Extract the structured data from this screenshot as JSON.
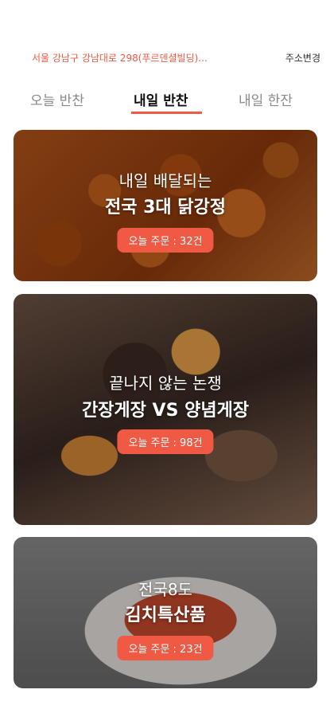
{
  "header": {
    "address": "서울 강남구 강남대로 298(푸르덴셜빌딩)...",
    "change_address": "주소변경"
  },
  "tabs": [
    {
      "label": "오늘 반찬",
      "active": false
    },
    {
      "label": "내일 반찬",
      "active": true
    },
    {
      "label": "내일 한잔",
      "active": false
    }
  ],
  "cards": [
    {
      "subtitle": "내일 배달되는",
      "title": "전국 3대 닭강정",
      "orders": "오늘 주문 : 32건"
    },
    {
      "subtitle": "끝나지 않는 논쟁",
      "title": "간장게장 VS 양념게장",
      "orders": "오늘 주문 : 98건"
    },
    {
      "subtitle": "전국8도",
      "title": "김치특산품",
      "orders": "오늘 주문 : 23건"
    }
  ],
  "colors": {
    "accent": "#f05a44",
    "tab_active": "#111111",
    "tab_inactive": "#8a8a8a"
  }
}
